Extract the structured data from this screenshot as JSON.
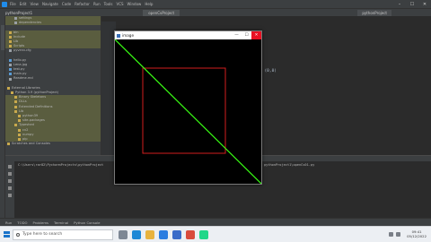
{
  "ide": {
    "menu_items": [
      "File",
      "Edit",
      "View",
      "Navigate",
      "Code",
      "Refactor",
      "Run",
      "Tools",
      "VCS",
      "Window",
      "Help"
    ],
    "project_crumb": "pythonProject1",
    "editor_tab": "openCvProject",
    "run_config": "pythonProject",
    "code_fragment": "(0,0)",
    "project_tree": [
      {
        "label": "settings",
        "kind": "file",
        "hl": true
      },
      {
        "label": "dependencies",
        "kind": "file",
        "hl": true
      },
      {
        "label": "",
        "kind": "none",
        "hl": false
      },
      {
        "label": "bin",
        "kind": "folder",
        "hl": true
      },
      {
        "label": "Include",
        "kind": "folder",
        "hl": true
      },
      {
        "label": "Lib",
        "kind": "folder",
        "hl": true
      },
      {
        "label": "Scripts",
        "kind": "folder",
        "hl": true
      },
      {
        "label": "pyvenv.cfg",
        "kind": "file",
        "hl": false
      },
      {
        "label": "",
        "kind": "none",
        "hl": false
      },
      {
        "label": "hello.py",
        "kind": "py",
        "hl": false
      },
      {
        "label": "Lena.jpg",
        "kind": "file",
        "hl": false
      },
      {
        "label": "test.py",
        "kind": "py",
        "hl": false
      },
      {
        "label": "main.py",
        "kind": "py",
        "hl": false
      },
      {
        "label": "Readme.md",
        "kind": "file",
        "hl": false
      },
      {
        "label": "",
        "kind": "none",
        "hl": false
      },
      {
        "label": "External Libraries",
        "kind": "folder",
        "hl": false
      },
      {
        "label": "Python 3.9 (pythonProject)",
        "kind": "folder",
        "hl": false
      },
      {
        "label": "Binary Skeletons",
        "kind": "folder",
        "hl": true
      },
      {
        "label": "DLLs",
        "kind": "folder",
        "hl": true
      },
      {
        "label": "Extended Definitions",
        "kind": "folder",
        "hl": true
      },
      {
        "label": "Lib",
        "kind": "folder",
        "hl": true
      },
      {
        "label": "python39",
        "kind": "folder",
        "hl": true
      },
      {
        "label": "site-packages",
        "kind": "folder",
        "hl": true
      },
      {
        "label": "Typeshed",
        "kind": "folder",
        "hl": true
      },
      {
        "label": "cv2",
        "kind": "folder",
        "hl": true
      },
      {
        "label": "numpy",
        "kind": "folder",
        "hl": true
      },
      {
        "label": "pip",
        "kind": "folder",
        "hl": true
      },
      {
        "label": "Scratches and Consoles",
        "kind": "folder",
        "hl": false
      }
    ],
    "run_path_left": "C:\\Users\\rar82\\PycharmProjects\\pythonProject",
    "run_path_right": "pythonProject1\\openCv01.py",
    "bottom_tabs": [
      "Run",
      "TODO",
      "Problems",
      "Terminal",
      "Python Console"
    ]
  },
  "floating_window": {
    "title": "image",
    "buttons": {
      "minimize": "—",
      "maximize": "☐",
      "close": "✕"
    },
    "drawing": {
      "background": "#000000",
      "line_color": "#39ff14",
      "rect_color": "#d21e1e"
    }
  },
  "taskbar": {
    "search_placeholder": "Type here to search",
    "clock_time": "09:41",
    "clock_date": "05/12/2022",
    "app_icons": [
      {
        "name": "task-view-icon",
        "color": "#7d8794"
      },
      {
        "name": "edge-icon",
        "color": "#1d88d6"
      },
      {
        "name": "file-explorer-icon",
        "color": "#e8b33f"
      },
      {
        "name": "store-icon",
        "color": "#2b7de0"
      },
      {
        "name": "mail-icon",
        "color": "#3a6bc8"
      },
      {
        "name": "chrome-icon",
        "color": "#d94b3c"
      },
      {
        "name": "pycharm-icon",
        "color": "#21d789"
      }
    ]
  }
}
